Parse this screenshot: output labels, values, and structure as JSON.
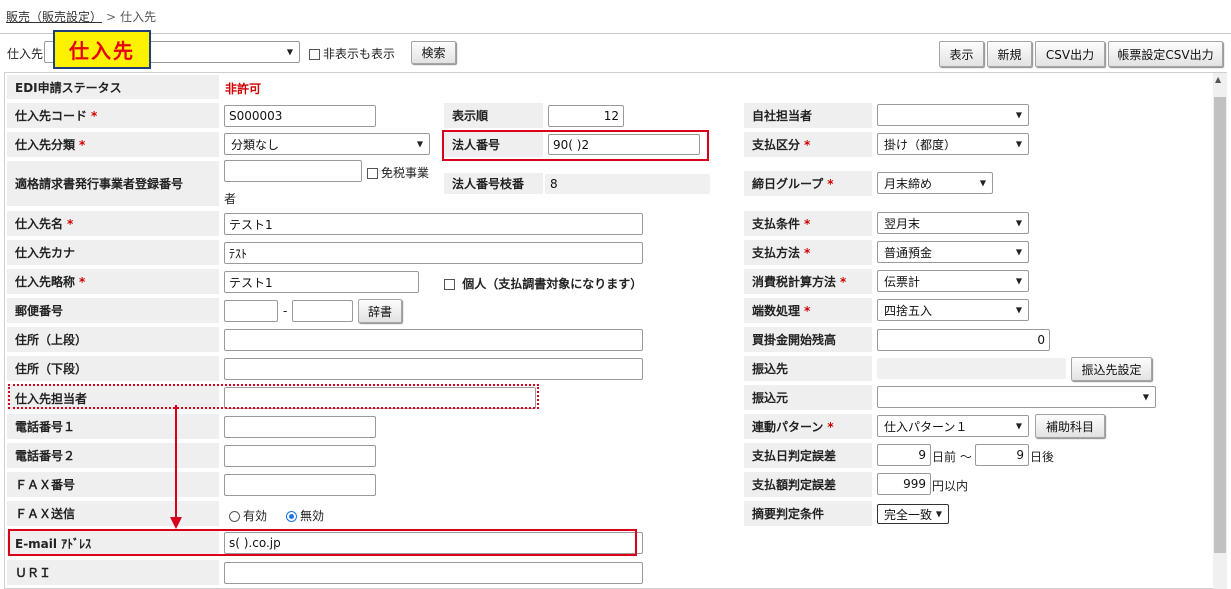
{
  "breadcrumb": {
    "parent": "販売（販売設定）",
    "separator": ">",
    "current": "仕入先"
  },
  "overlay_title": "仕入先",
  "toolbar": {
    "field_label": "仕入先",
    "hidden_checkbox_label": "非表示も表示",
    "search_button": "検索",
    "display_button": "表示",
    "new_button": "新規",
    "csv_button": "CSV出力",
    "form_csv_button": "帳票設定CSV出力"
  },
  "form": {
    "edi_status": {
      "label": "EDI申請ステータス",
      "value": "非許可"
    },
    "code": {
      "label": "仕入先コード",
      "value": "S000003"
    },
    "display_order": {
      "label": "表示順",
      "value": "12"
    },
    "company_staff": {
      "label": "自社担当者",
      "value": ""
    },
    "category": {
      "label": "仕入先分類",
      "value": "分類なし"
    },
    "corporate_number": {
      "label": "法人番号",
      "value": "90(                   )2"
    },
    "payment_type": {
      "label": "支払区分",
      "value": "掛け（都度）"
    },
    "invoice_reg": {
      "label": "適格請求書発行事業者登録番号",
      "value": "",
      "exempt_label_1": "免税事業",
      "exempt_label_2": "者"
    },
    "corporate_branch": {
      "label": "法人番号枝番",
      "value": "8"
    },
    "closing_group": {
      "label": "締日グループ",
      "value": "月末締め"
    },
    "name": {
      "label": "仕入先名",
      "value": "テスト1"
    },
    "payment_terms": {
      "label": "支払条件",
      "value": "翌月末"
    },
    "kana": {
      "label": "仕入先カナ",
      "value": "ﾃｽﾄ"
    },
    "payment_method": {
      "label": "支払方法",
      "value": "普通預金"
    },
    "short_name": {
      "label": "仕入先略称",
      "value": "テスト1",
      "individual_label": "個人（支払調書対象になります）"
    },
    "tax_calc": {
      "label": "消費税計算方法",
      "value": "伝票計"
    },
    "postal": {
      "label": "郵便番号",
      "dash": "-",
      "dict_button": "辞書"
    },
    "rounding": {
      "label": "端数処理",
      "value": "四捨五入"
    },
    "address1": {
      "label": "住所（上段）"
    },
    "opening_balance": {
      "label": "買掛金開始残高",
      "value": "0"
    },
    "address2": {
      "label": "住所（下段）"
    },
    "transfer_to": {
      "label": "振込先",
      "button": "振込先設定"
    },
    "contact": {
      "label": "仕入先担当者"
    },
    "transfer_from": {
      "label": "振込元",
      "value": ""
    },
    "phone1": {
      "label": "電話番号１"
    },
    "link_pattern": {
      "label": "連動パターン",
      "value": "仕入パターン１",
      "button": "補助科目"
    },
    "phone2": {
      "label": "電話番号２"
    },
    "date_tolerance": {
      "label": "支払日判定誤差",
      "before_value": "9",
      "before_unit": "日前 ～",
      "after_value": "9",
      "after_unit": "日後"
    },
    "fax": {
      "label": "ＦＡＸ番号"
    },
    "amount_tolerance": {
      "label": "支払額判定誤差",
      "value": "999",
      "unit": "円以内"
    },
    "fax_send": {
      "label": "ＦＡＸ送信",
      "opt_on": "有効",
      "opt_off": "無効"
    },
    "summary_condition": {
      "label": "摘要判定条件",
      "value": "完全一致"
    },
    "email": {
      "label": "E-mail ｱﾄﾞﾚｽ",
      "value": "s(                              ).co.jp"
    },
    "url": {
      "label": "ＵＲＩ"
    }
  },
  "required_mark": "*",
  "colors": {
    "accent_red": "#d9001b",
    "badge_yellow": "#fff200",
    "badge_border": "#1f3f7a"
  }
}
